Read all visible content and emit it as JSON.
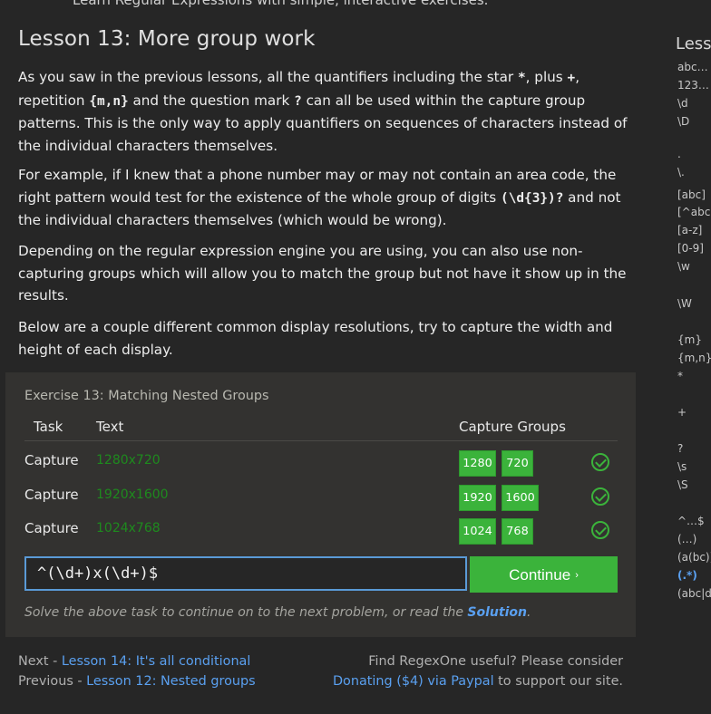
{
  "header": {
    "cut_text": "Learn Regular Expressions with simple, interactive exercises."
  },
  "lesson": {
    "title": "Lesson 13: More group work",
    "p1": {
      "a": "As you saw in the previous lessons, all the quantifiers including the star ",
      "b": "*",
      "c": ", plus ",
      "d": "+",
      "e": ", repetition ",
      "f": "{m,n}",
      "g": " and the question mark ",
      "h": "?",
      "i": " can all be used within the capture group patterns. This is the only way to apply quantifiers on sequences of characters instead of the individual characters themselves."
    },
    "p2": {
      "a": "For example, if I knew that a phone number may or may not contain an area code, the right pattern would test for the existence of the whole group of digits ",
      "b": "(\\d{3})?",
      "c": " and not the individual characters themselves (which would be wrong)."
    },
    "p3": "Depending on the regular expression engine you are using, you can also use non-capturing groups which will allow you to match the group but not have it show up in the results.",
    "p4": "Below are a couple different common display resolutions, try to capture the width and height of each display."
  },
  "exercise": {
    "title": "Exercise 13: Matching Nested Groups",
    "headers": {
      "task": "Task",
      "text": "Text",
      "capture": "Capture Groups"
    },
    "rows": [
      {
        "task": "Capture",
        "text": "1280x720",
        "groups": [
          "1280",
          "720"
        ],
        "status": "success"
      },
      {
        "task": "Capture",
        "text": "1920x1600",
        "groups": [
          "1920",
          "1600"
        ],
        "status": "success"
      },
      {
        "task": "Capture",
        "text": "1024x768",
        "groups": [
          "1024",
          "768"
        ],
        "status": "success"
      }
    ],
    "input_value": "^(\\d+)x(\\d+)$",
    "continue_label": "Continue",
    "continue_arrow": "›",
    "hint_text": "Solve the above task to continue on to the next problem, or read the ",
    "solution_link": "Solution",
    "hint_end": "."
  },
  "footer": {
    "next_prefix": "Next - ",
    "next_link": "Lesson 14: It's all conditional",
    "prev_prefix": "Previous - ",
    "prev_link": "Lesson 12: Nested groups",
    "right_line1": "Find RegexOne useful? Please consider",
    "donate_link": "Donating ($4) via Paypal",
    "right_line2_suffix": " to support our site."
  },
  "sidebar": {
    "title": "Lesson Notes",
    "items": [
      "abc…",
      "123…",
      "\\d",
      "\\D",
      ".",
      "\\.",
      "[abc]",
      "[^abc]",
      "[a-z]",
      "[0-9]",
      "\\w",
      "\\W",
      "{m}",
      "{m,n}",
      "*",
      "+",
      "?",
      "\\s",
      "\\S",
      "^…$",
      "(…)",
      "(a(bc))",
      "(.*)",
      "(abc|def)"
    ]
  },
  "colors": {
    "accent": "#3bb33b",
    "link": "#5aa0f0",
    "background": "#262626",
    "panel": "#333230"
  }
}
